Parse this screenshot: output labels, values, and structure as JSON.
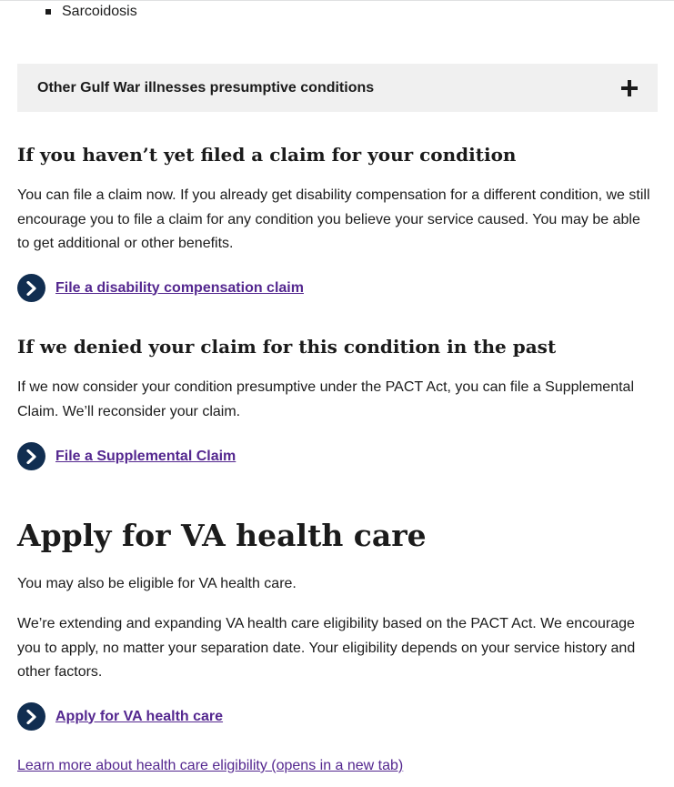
{
  "list": {
    "items": [
      "Sarcoidosis"
    ]
  },
  "accordion": {
    "label": "Other Gulf War illnesses presumptive conditions"
  },
  "section_not_filed": {
    "heading": "If you haven’t yet filed a claim for your condition",
    "body": "You can file a claim now. If you already get disability compensation for a different condition, we still encourage you to file a claim for any condition you believe your service caused. You may be able to get additional or other benefits.",
    "link": "File a disability compensation claim"
  },
  "section_denied": {
    "heading": "If we denied your claim for this condition in the past",
    "body": "If we now consider your condition presumptive under the PACT Act, you can file a Supplemental Claim. We’ll reconsider your claim.",
    "link": "File a Supplemental Claim"
  },
  "section_health": {
    "heading": "Apply for VA health care",
    "body1": "You may also be eligible for VA health care.",
    "body2": "We’re extending and expanding VA health care eligibility based on the PACT Act. We encourage you to apply, no matter your separation date. Your eligibility depends on your service history and other factors.",
    "link": "Apply for VA health care",
    "learn_more": "Learn more about health care eligibility (opens in a new tab)"
  },
  "icons": {
    "action": "chevron-right-circle-icon",
    "expand": "plus-icon"
  },
  "colors": {
    "link": "#54278f",
    "action_icon": "#112e51",
    "accordion_bg": "#f0f0f0"
  }
}
